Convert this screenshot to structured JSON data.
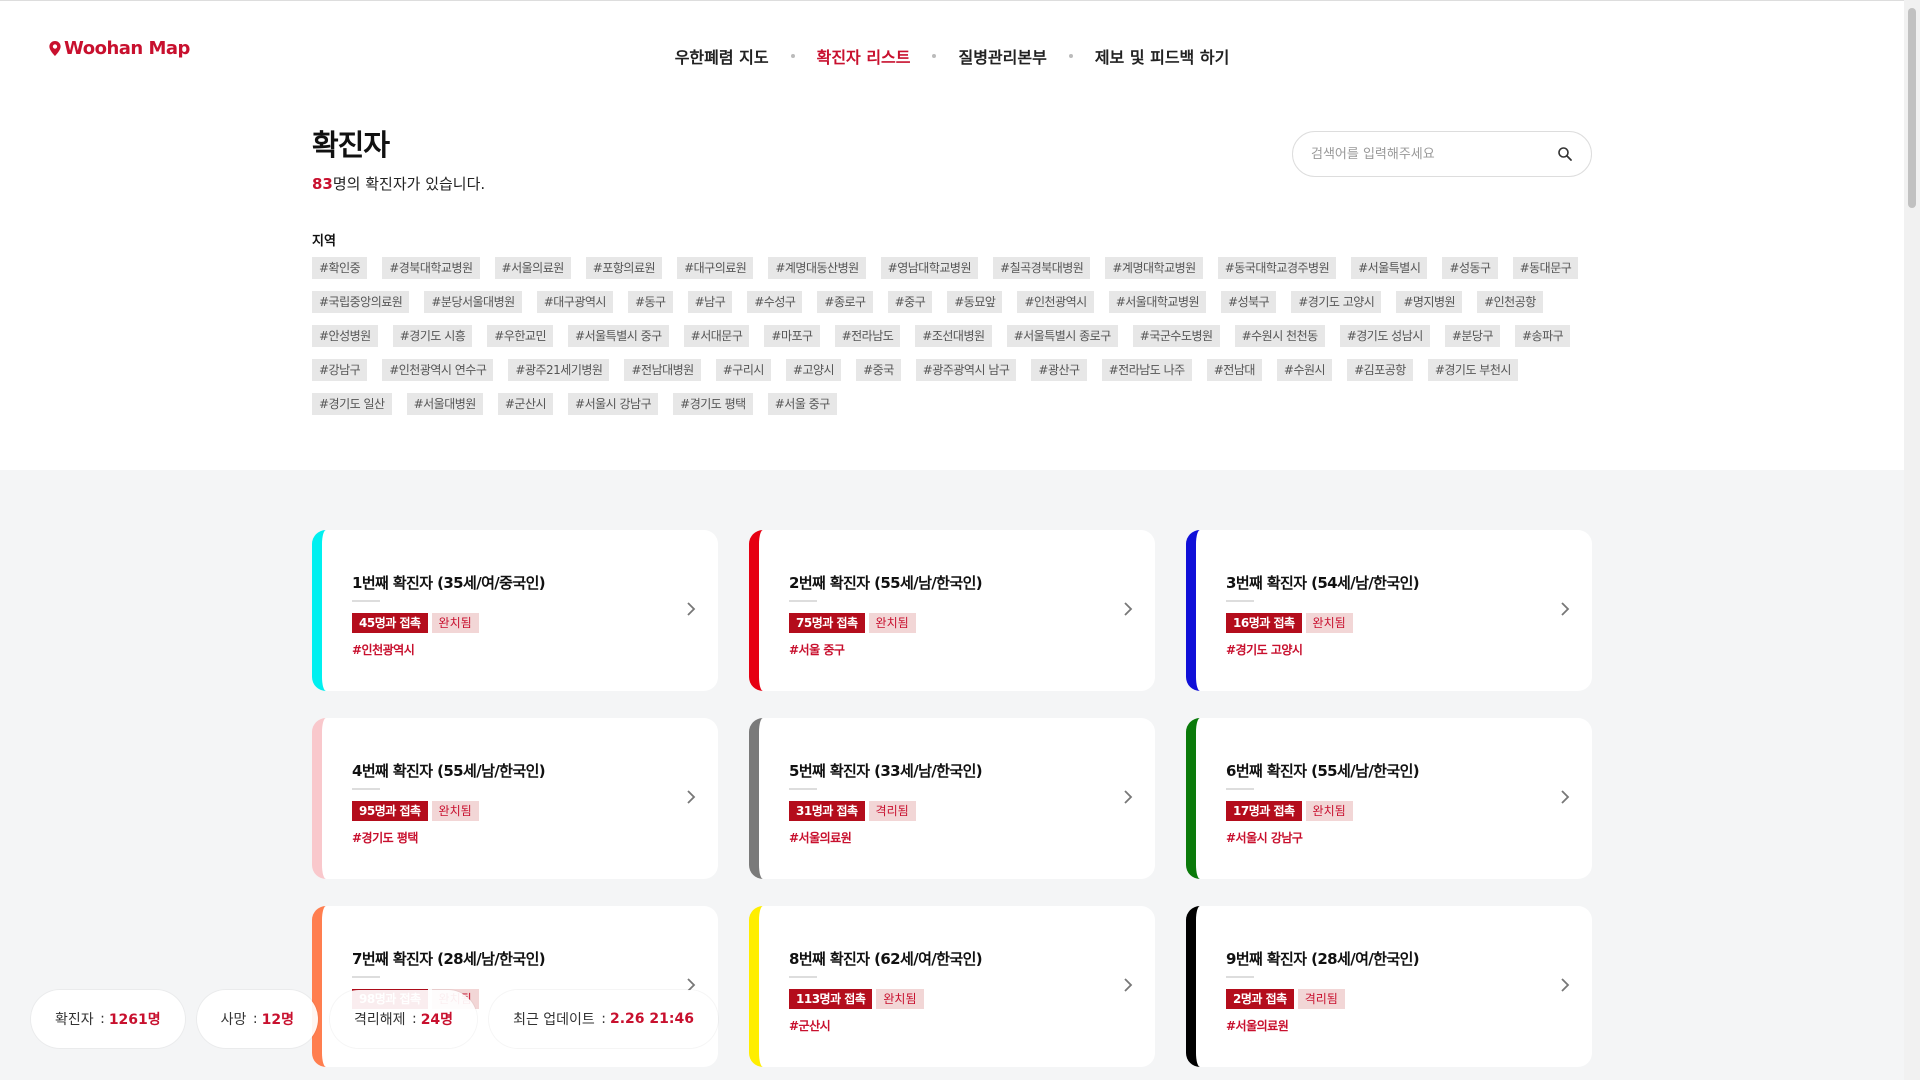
{
  "header": {
    "logo": "Woohan Map",
    "nav": [
      {
        "label": "우한폐렴 지도",
        "active": false
      },
      {
        "label": "확진자 리스트",
        "active": true
      },
      {
        "label": "질병관리본부",
        "active": false
      },
      {
        "label": "제보 및 피드백 하기",
        "active": false
      }
    ]
  },
  "main": {
    "title": "확진자",
    "count": "83",
    "count_suffix": "명의 확진자가 있습니다.",
    "search_placeholder": "검색어를 입력해주세요",
    "region_label": "지역",
    "tags": [
      "#확인중",
      "#경북대학교병원",
      "#서울의료원",
      "#포항의료원",
      "#대구의료원",
      "#계명대동산병원",
      "#영남대학교병원",
      "#칠곡경북대병원",
      "#계명대학교병원",
      "#동국대학교경주병원",
      "#서울특별시",
      "#성동구",
      "#동대문구",
      "#국립중앙의료원",
      "#분당서울대병원",
      "#대구광역시",
      "#동구",
      "#남구",
      "#수성구",
      "#종로구",
      "#중구",
      "#동묘앞",
      "#인천광역시",
      "#서울대학교병원",
      "#성북구",
      "#경기도 고양시",
      "#명지병원",
      "#인천공항",
      "#안성병원",
      "#경기도 시흥",
      "#우한교민",
      "#서울특별시 중구",
      "#서대문구",
      "#마포구",
      "#전라남도",
      "#조선대병원",
      "#서울특별시 종로구",
      "#국군수도병원",
      "#수원시 천천동",
      "#경기도 성남시",
      "#분당구",
      "#송파구",
      "#강남구",
      "#인천광역시 연수구",
      "#광주21세기병원",
      "#전남대병원",
      "#구리시",
      "#고양시",
      "#중국",
      "#광주광역시 남구",
      "#광산구",
      "#전라남도 나주",
      "#전남대",
      "#수원시",
      "#김포공항",
      "#경기도 부천시",
      "#경기도 일산",
      "#서울대병원",
      "#군산시",
      "#서울시 강남구",
      "#경기도 평택",
      "#서울 중구"
    ]
  },
  "patients": [
    {
      "title": "1번째 확진자 (35세/여/중국인)",
      "contact": "45명과 접촉",
      "status": "완치됨",
      "region": "#인천광역시",
      "color": "#00f0f0"
    },
    {
      "title": "2번째 확진자 (55세/남/한국인)",
      "contact": "75명과 접촉",
      "status": "완치됨",
      "region": "#서울 중구",
      "color": "#e60012"
    },
    {
      "title": "3번째 확진자 (54세/남/한국인)",
      "contact": "16명과 접촉",
      "status": "완치됨",
      "region": "#경기도 고양시",
      "color": "#1010d8"
    },
    {
      "title": "4번째 확진자 (55세/남/한국인)",
      "contact": "95명과 접촉",
      "status": "완치됨",
      "region": "#경기도 평택",
      "color": "#f9c8cc"
    },
    {
      "title": "5번째 확진자 (33세/남/한국인)",
      "contact": "31명과 접촉",
      "status": "격리됨",
      "region": "#서울의료원",
      "color": "#7a7a7a"
    },
    {
      "title": "6번째 확진자 (55세/남/한국인)",
      "contact": "17명과 접촉",
      "status": "완치됨",
      "region": "#서울시 강남구",
      "color": "#0a7a0a"
    },
    {
      "title": "7번째 확진자 (28세/남/한국인)",
      "contact": "98명과 접촉",
      "status": "완치됨",
      "region": "",
      "color": "#ff7e4f"
    },
    {
      "title": "8번째 확진자 (62세/여/한국인)",
      "contact": "113명과 접촉",
      "status": "완치됨",
      "region": "#군산시",
      "color": "#ffee00"
    },
    {
      "title": "9번째 확진자 (28세/여/한국인)",
      "contact": "2명과 접촉",
      "status": "격리됨",
      "region": "#서울의료원",
      "color": "#000000"
    }
  ],
  "stats": {
    "confirmed_label": "확진자",
    "confirmed_value": "1261명",
    "death_label": "사망",
    "death_value": "12명",
    "released_label": "격리해제",
    "released_value": "24명",
    "updated_label": "최근 업데이트",
    "updated_value": "2.26 21:46"
  }
}
